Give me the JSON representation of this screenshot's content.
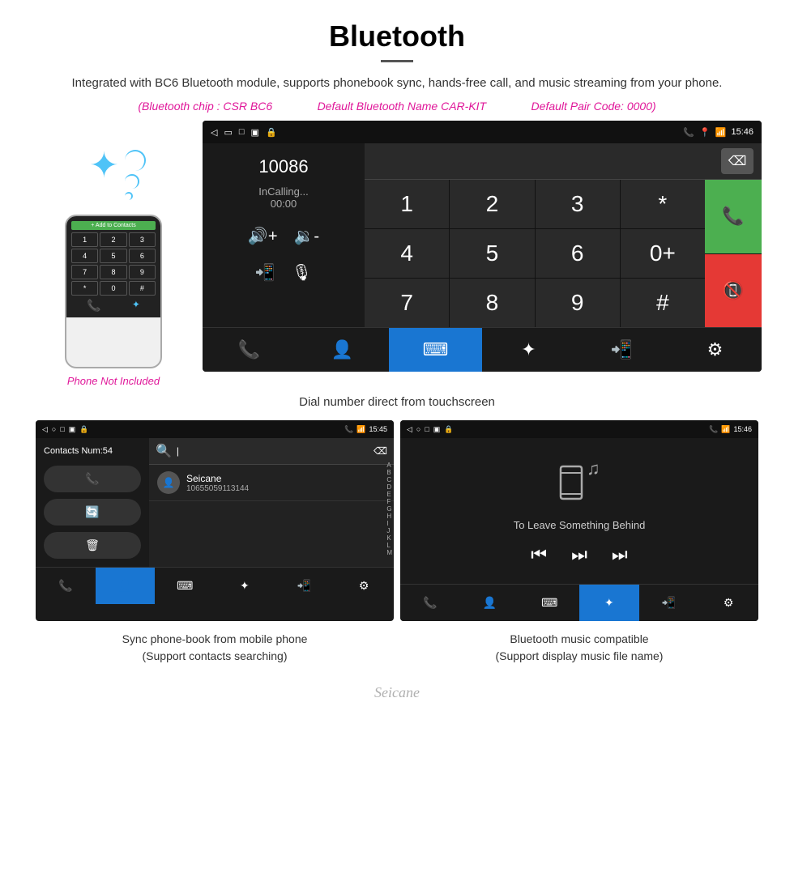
{
  "header": {
    "title": "Bluetooth",
    "description": "Integrated with BC6 Bluetooth module, supports phonebook sync, hands-free call, and music streaming from your phone.",
    "specs": {
      "chip": "(Bluetooth chip : CSR BC6",
      "name": "Default Bluetooth Name CAR-KIT",
      "pair": "Default Pair Code: 0000)"
    }
  },
  "dial_screen": {
    "status_time": "15:46",
    "number": "10086",
    "status": "InCalling...",
    "timer": "00:00",
    "caption": "Dial number direct from touchscreen",
    "keys": [
      "1",
      "2",
      "3",
      "*",
      "",
      "4",
      "5",
      "6",
      "0+",
      "",
      "7",
      "8",
      "9",
      "#",
      ""
    ]
  },
  "phone_side": {
    "not_included": "Phone Not Included",
    "add_contacts": "+ Add to Contacts"
  },
  "contacts_screen": {
    "status_time": "15:45",
    "contacts_num": "Contacts Num:54",
    "contact_name": "Seicane",
    "contact_number": "10655059113144",
    "alphabet": [
      "A",
      "B",
      "C",
      "D",
      "E",
      "F",
      "G",
      "H",
      "I",
      "J",
      "K",
      "L",
      "M"
    ],
    "caption_line1": "Sync phone-book from mobile phone",
    "caption_line2": "(Support contacts searching)"
  },
  "music_screen": {
    "status_time": "15:46",
    "song_title": "To Leave Something Behind",
    "caption_line1": "Bluetooth music compatible",
    "caption_line2": "(Support display music file name)"
  },
  "watermark": "Seicane"
}
